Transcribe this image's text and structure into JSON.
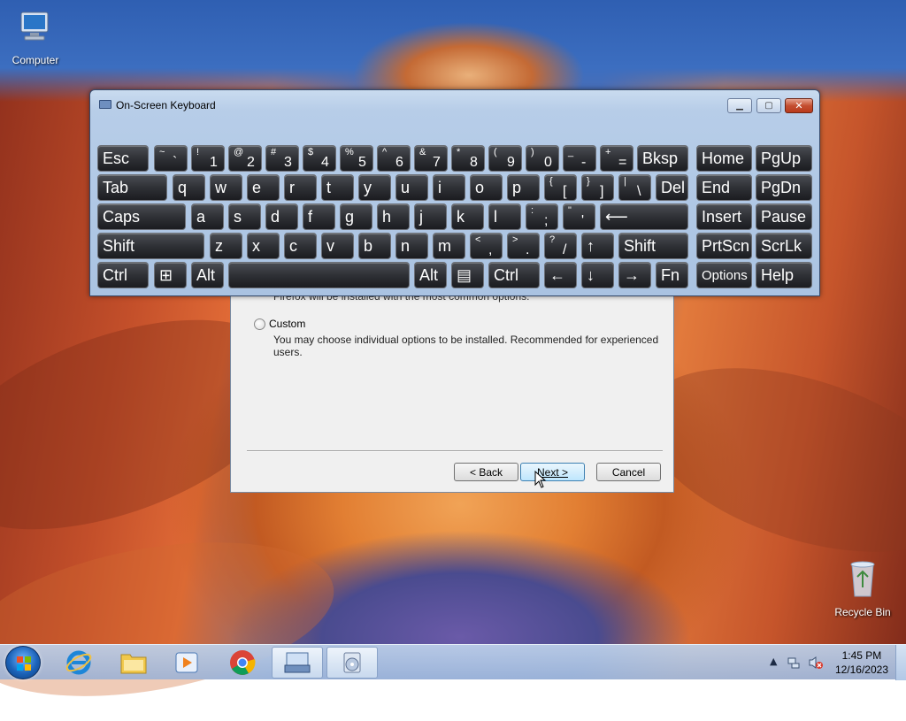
{
  "desktop": {
    "icons": [
      {
        "label": "Computer",
        "icon": "computer-icon"
      },
      {
        "label": "Recycle Bin",
        "icon": "recycle-bin-icon"
      }
    ]
  },
  "setup_dialog": {
    "partial_text": "Firefox will be installed with the most common options.",
    "custom_label": "Custom",
    "custom_description": "You may choose individual options to be installed. Recommended for experienced users.",
    "back_label": "< Back",
    "next_label": "Next >",
    "cancel_label": "Cancel"
  },
  "osk": {
    "title": "On-Screen Keyboard",
    "rows": [
      [
        {
          "label": "Esc"
        },
        {
          "top": "~",
          "bottom": "`"
        },
        {
          "top": "!",
          "bottom": "1"
        },
        {
          "top": "@",
          "bottom": "2"
        },
        {
          "top": "#",
          "bottom": "3"
        },
        {
          "top": "$",
          "bottom": "4"
        },
        {
          "top": "%",
          "bottom": "5"
        },
        {
          "top": "^",
          "bottom": "6"
        },
        {
          "top": "&",
          "bottom": "7"
        },
        {
          "top": "*",
          "bottom": "8"
        },
        {
          "top": "(",
          "bottom": "9"
        },
        {
          "top": ")",
          "bottom": "0"
        },
        {
          "top": "_",
          "bottom": "-"
        },
        {
          "top": "+",
          "bottom": "="
        },
        {
          "label": "Bksp"
        },
        {
          "label": "Home"
        },
        {
          "label": "PgUp"
        }
      ],
      [
        {
          "label": "Tab"
        },
        {
          "label": "q"
        },
        {
          "label": "w"
        },
        {
          "label": "e"
        },
        {
          "label": "r"
        },
        {
          "label": "t"
        },
        {
          "label": "y"
        },
        {
          "label": "u"
        },
        {
          "label": "i"
        },
        {
          "label": "o"
        },
        {
          "label": "p"
        },
        {
          "top": "{",
          "bottom": "["
        },
        {
          "top": "}",
          "bottom": "]"
        },
        {
          "top": "|",
          "bottom": "\\"
        },
        {
          "label": "Del"
        },
        {
          "label": "End"
        },
        {
          "label": "PgDn"
        }
      ],
      [
        {
          "label": "Caps"
        },
        {
          "label": "a"
        },
        {
          "label": "s"
        },
        {
          "label": "d"
        },
        {
          "label": "f"
        },
        {
          "label": "g"
        },
        {
          "label": "h"
        },
        {
          "label": "j"
        },
        {
          "label": "k"
        },
        {
          "label": "l"
        },
        {
          "top": ":",
          "bottom": ";"
        },
        {
          "top": "\"",
          "bottom": "'"
        },
        {
          "label": "⟵"
        },
        {
          "label": "Insert"
        },
        {
          "label": "Pause"
        }
      ],
      [
        {
          "label": "Shift"
        },
        {
          "label": "z"
        },
        {
          "label": "x"
        },
        {
          "label": "c"
        },
        {
          "label": "v"
        },
        {
          "label": "b"
        },
        {
          "label": "n"
        },
        {
          "label": "m"
        },
        {
          "top": "<",
          "bottom": ","
        },
        {
          "top": ">",
          "bottom": "."
        },
        {
          "top": "?",
          "bottom": "/"
        },
        {
          "label": "↑"
        },
        {
          "label": "Shift"
        },
        {
          "label": "PrtScn"
        },
        {
          "label": "ScrLk"
        }
      ],
      [
        {
          "label": "Ctrl"
        },
        {
          "label": "⊞"
        },
        {
          "label": "Alt"
        },
        {
          "label": ""
        },
        {
          "label": "Alt"
        },
        {
          "label": "▤"
        },
        {
          "label": "Ctrl"
        },
        {
          "label": "←"
        },
        {
          "label": "↓"
        },
        {
          "label": "→"
        },
        {
          "label": "Fn"
        },
        {
          "label": "Options"
        },
        {
          "label": "Help"
        }
      ]
    ]
  },
  "taskbar": {
    "items": [
      {
        "name": "internet-explorer",
        "icon": "ie-icon"
      },
      {
        "name": "windows-explorer",
        "icon": "folder-icon"
      },
      {
        "name": "media-player",
        "icon": "media-player-icon"
      },
      {
        "name": "chrome",
        "icon": "chrome-icon"
      },
      {
        "name": "on-screen-keyboard",
        "icon": "keyboard-icon"
      },
      {
        "name": "setup-installer",
        "icon": "installer-icon"
      }
    ],
    "clock_time": "1:45 PM",
    "clock_date": "12/16/2023"
  }
}
